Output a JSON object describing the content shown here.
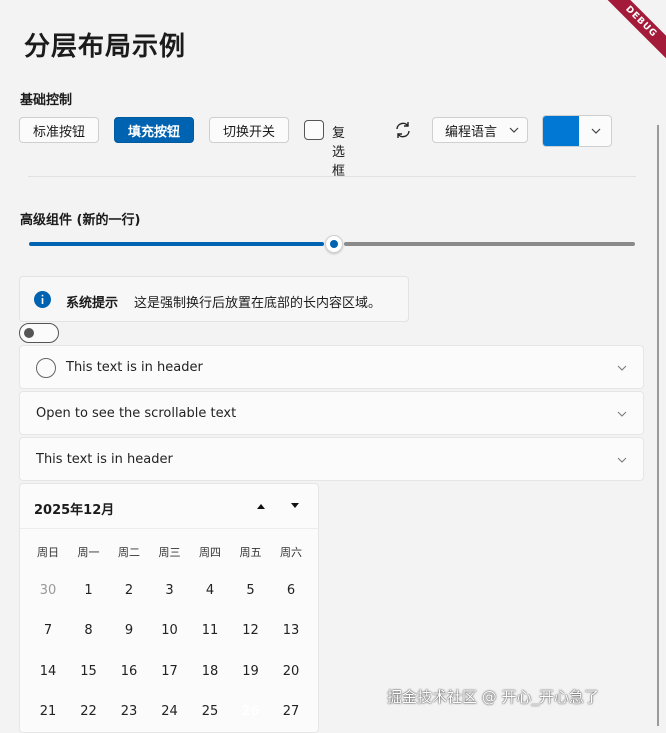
{
  "page": {
    "title": "分层布局示例",
    "debug_badge": "DEBUG"
  },
  "basic": {
    "label": "基础控制",
    "standard_button": "标准按钮",
    "filled_button": "填充按钮",
    "toggle_button": "切换开关",
    "checkbox_label": "复选框",
    "refresh_icon": "refresh-icon",
    "combo_value": "编程语言",
    "color_value": "#0078d4"
  },
  "advanced": {
    "label": "高级组件 (新的一行)",
    "slider_value_fraction": 0.5,
    "infobar": {
      "title": "系统提示",
      "message": "这是强制换行后放置在底部的长内容区域。"
    },
    "toggle_on": false,
    "expanders": [
      {
        "label": "This text is in header",
        "has_radio": true
      },
      {
        "label": "Open to see the scrollable text",
        "has_radio": false
      },
      {
        "label": "This text is in header",
        "has_radio": false
      }
    ]
  },
  "calendar": {
    "month_label": "2025年12月",
    "weekdays": [
      "周日",
      "周一",
      "周二",
      "周三",
      "周四",
      "周五",
      "周六"
    ],
    "weeks": [
      [
        {
          "d": "30",
          "muted": true
        },
        {
          "d": "1"
        },
        {
          "d": "2"
        },
        {
          "d": "3"
        },
        {
          "d": "4"
        },
        {
          "d": "5"
        },
        {
          "d": "6"
        }
      ],
      [
        {
          "d": "7"
        },
        {
          "d": "8"
        },
        {
          "d": "9"
        },
        {
          "d": "10"
        },
        {
          "d": "11"
        },
        {
          "d": "12"
        },
        {
          "d": "13"
        }
      ],
      [
        {
          "d": "14"
        },
        {
          "d": "15"
        },
        {
          "d": "16"
        },
        {
          "d": "17"
        },
        {
          "d": "18"
        },
        {
          "d": "19"
        },
        {
          "d": "20"
        }
      ],
      [
        {
          "d": "21"
        },
        {
          "d": "22"
        },
        {
          "d": "23"
        },
        {
          "d": "24"
        },
        {
          "d": "25"
        },
        {
          "d": "26",
          "selected": true
        },
        {
          "d": "27"
        }
      ]
    ]
  },
  "watermark": "掘金技术社区 @ 开心_开心急了"
}
